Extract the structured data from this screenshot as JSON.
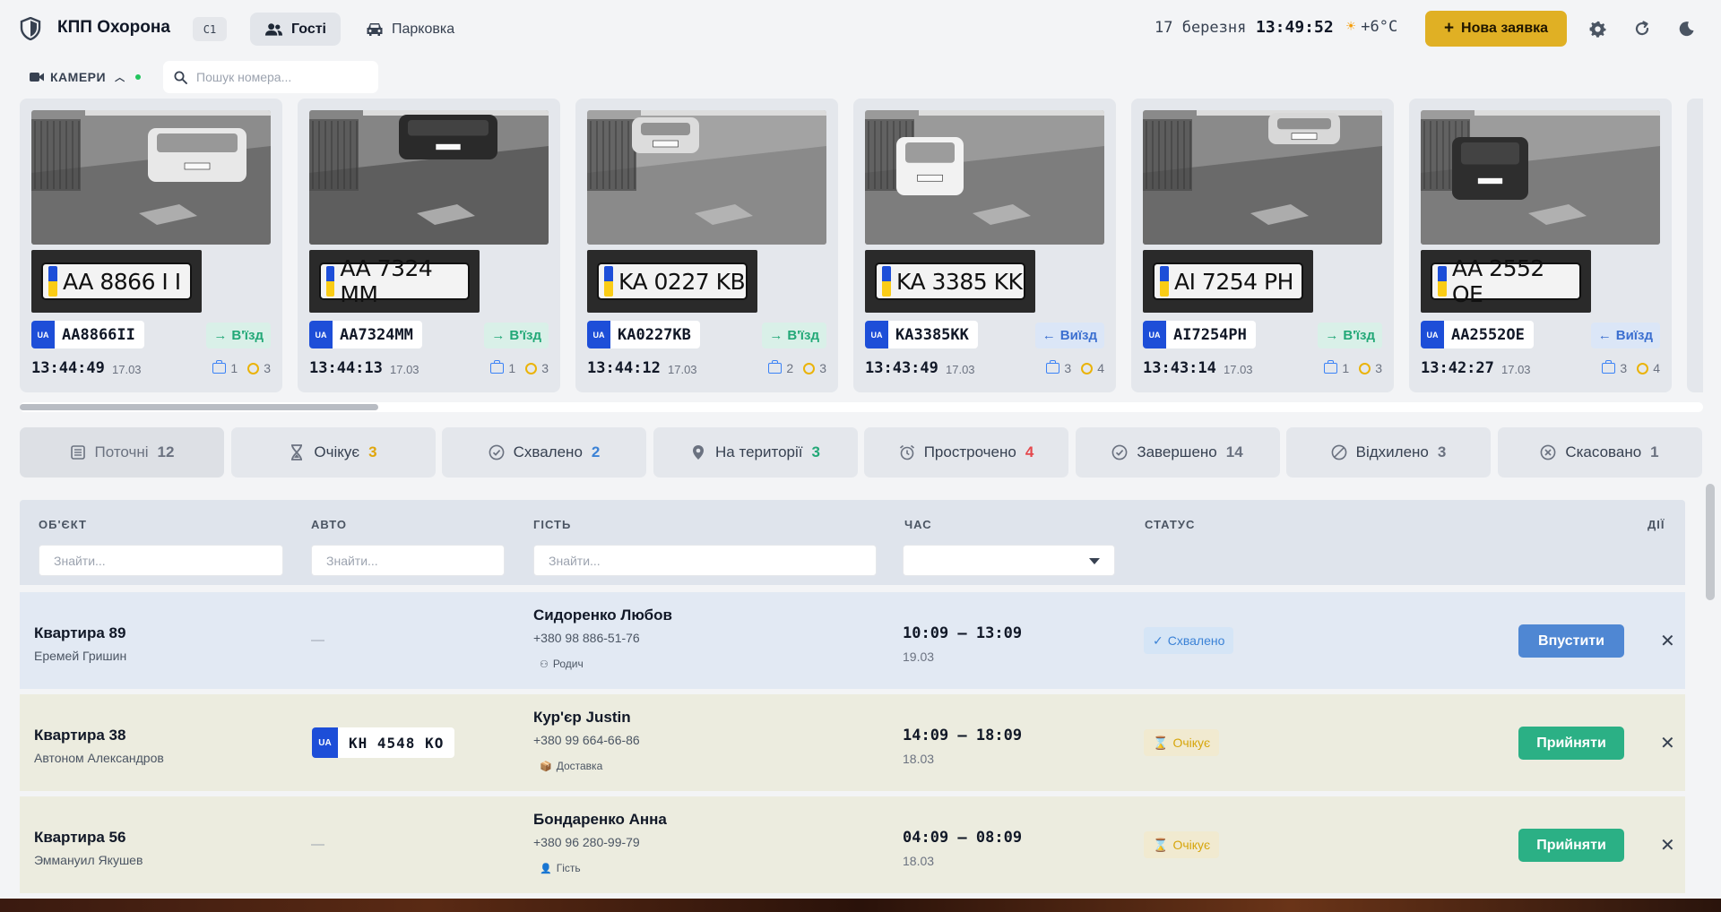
{
  "header": {
    "app_title": "КПП Охорона",
    "checkpoint_badge": "C1",
    "nav": [
      {
        "label": "Гості",
        "icon": "users-icon",
        "active": true
      },
      {
        "label": "Парковка",
        "icon": "car-icon",
        "active": false
      }
    ],
    "date": "17 березня",
    "time": "13:49:52",
    "weather": "+6°C",
    "new_request_label": "Нова заявка",
    "accent_color": "#e0b024"
  },
  "cameras": {
    "toggle_label": "КАМЕРИ",
    "search_placeholder": "Пошук номера...",
    "events": [
      {
        "plate_photo": "AA 8866 I I",
        "plate": "AA8866II",
        "direction": "В'їзд",
        "dir": "in",
        "time": "13:44:49",
        "date": "17.03",
        "bags": "1",
        "pending": "3"
      },
      {
        "plate_photo": "AA 7324 MM",
        "plate": "AA7324MM",
        "direction": "В'їзд",
        "dir": "in",
        "time": "13:44:13",
        "date": "17.03",
        "bags": "1",
        "pending": "3"
      },
      {
        "plate_photo": "KA 0227 KB",
        "plate": "KA0227KB",
        "direction": "В'їзд",
        "dir": "in",
        "time": "13:44:12",
        "date": "17.03",
        "bags": "2",
        "pending": "3"
      },
      {
        "plate_photo": "KA 3385 KK",
        "plate": "KA3385KK",
        "direction": "Виїзд",
        "dir": "out",
        "time": "13:43:49",
        "date": "17.03",
        "bags": "3",
        "pending": "4"
      },
      {
        "plate_photo": "AI 7254 PH",
        "plate": "AI7254PH",
        "direction": "В'їзд",
        "dir": "in",
        "time": "13:43:14",
        "date": "17.03",
        "bags": "1",
        "pending": "3"
      },
      {
        "plate_photo": "AA 2552 OE",
        "plate": "AA2552OE",
        "direction": "Виїзд",
        "dir": "out",
        "time": "13:42:27",
        "date": "17.03",
        "bags": "3",
        "pending": "4"
      }
    ]
  },
  "filters": [
    {
      "label": "Поточні",
      "count": "12",
      "icon": "list-icon",
      "count_color": "#6b7280"
    },
    {
      "label": "Очікує",
      "count": "3",
      "icon": "hourglass-icon",
      "count_color": "#e0a60c"
    },
    {
      "label": "Схвалено",
      "count": "2",
      "icon": "check-circle-icon",
      "count_color": "#3b82d6"
    },
    {
      "label": "На території",
      "count": "3",
      "icon": "map-pin-icon",
      "count_color": "#22a877"
    },
    {
      "label": "Прострочено",
      "count": "4",
      "icon": "alarm-clock-icon",
      "count_color": "#e5484d"
    },
    {
      "label": "Завершено",
      "count": "14",
      "icon": "check-circle-icon",
      "count_color": "#6b7280"
    },
    {
      "label": "Відхилено",
      "count": "3",
      "icon": "ban-icon",
      "count_color": "#6b7280"
    },
    {
      "label": "Скасовано",
      "count": "1",
      "icon": "x-circle-icon",
      "count_color": "#6b7280"
    }
  ],
  "table": {
    "columns": {
      "object": "ОБ'ЄКТ",
      "car": "АВТО",
      "guest": "ГІСТЬ",
      "time": "ЧАС",
      "status": "СТАТУС",
      "actions": "ДІЇ"
    },
    "filter_placeholder": "Знайти...",
    "rows": [
      {
        "object": "Квартира 89",
        "owner": "Еремей Гришин",
        "plate": "",
        "guest": "Сидоренко Любов",
        "phone": "+380 98 886-51-76",
        "tag": "Родич",
        "tag_icon": "family-icon",
        "time": "10:09 — 13:09",
        "date": "19.03",
        "status": "Схвалено",
        "status_type": "approved",
        "action": "Впустити"
      },
      {
        "object": "Квартира 38",
        "owner": "Автоном Александров",
        "plate": "KH 4548 KO",
        "guest": "Кур'єр Justin",
        "phone": "+380 99 664-66-86",
        "tag": "Доставка",
        "tag_icon": "package-icon",
        "time": "14:09 — 18:09",
        "date": "18.03",
        "status": "Очікує",
        "status_type": "waiting",
        "action": "Прийняти"
      },
      {
        "object": "Квартира 56",
        "owner": "Эммануил Якушев",
        "plate": "",
        "guest": "Бондаренко Анна",
        "phone": "+380 96 280-99-79",
        "tag": "Гість",
        "tag_icon": "person-icon",
        "time": "04:09 — 08:09",
        "date": "18.03",
        "status": "Очікує",
        "status_type": "waiting",
        "action": "Прийняти"
      }
    ],
    "empty_car": "—"
  }
}
